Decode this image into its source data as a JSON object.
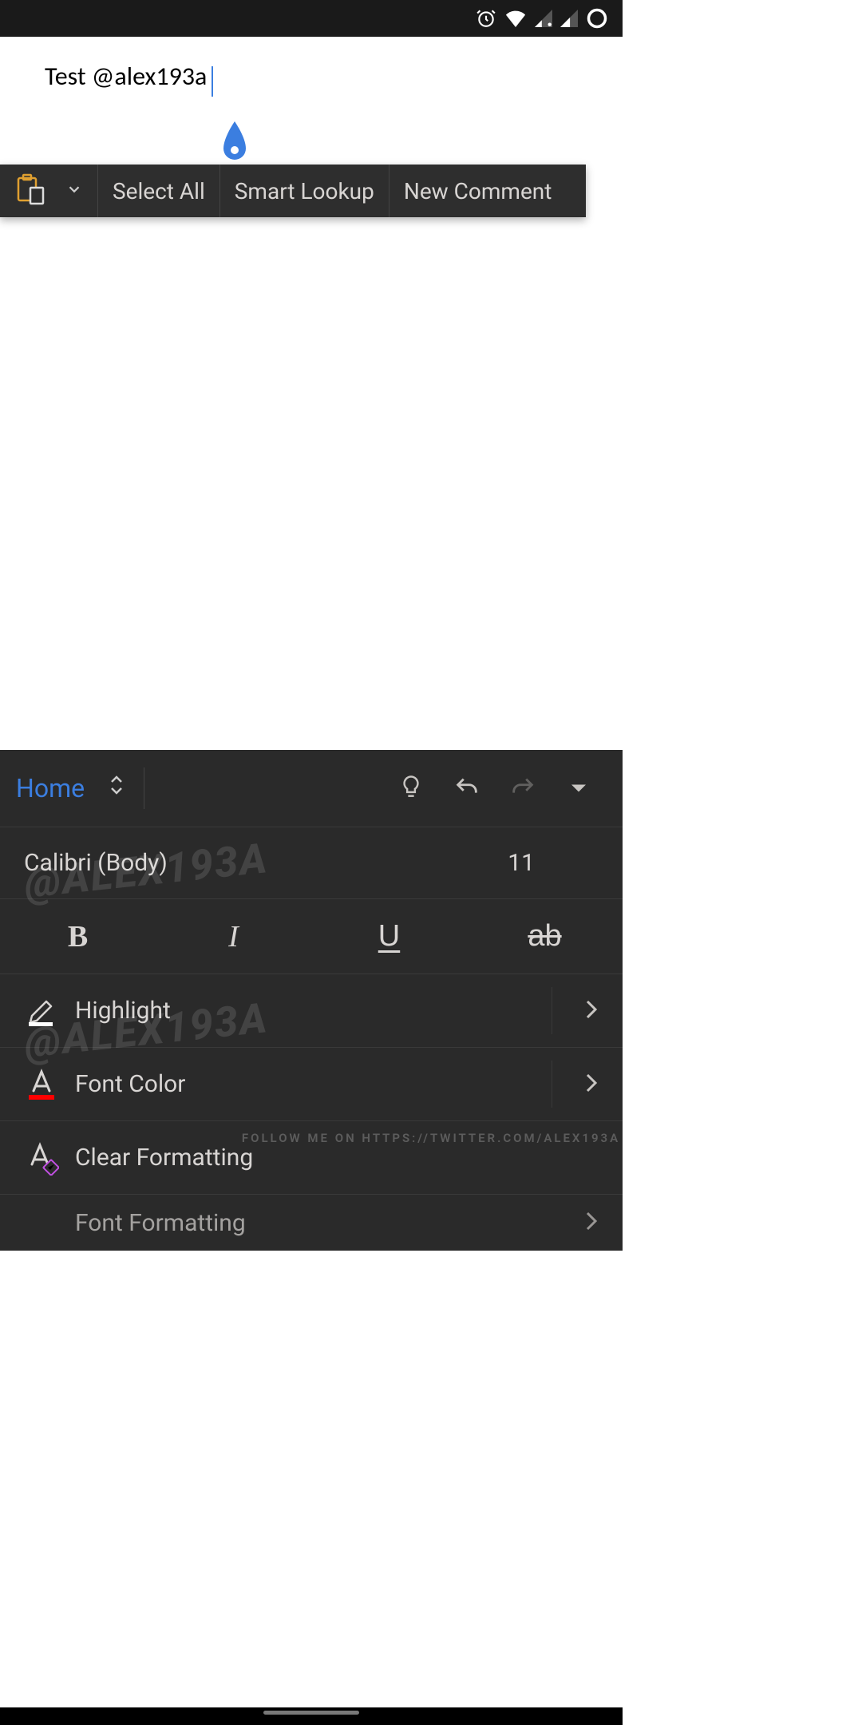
{
  "document": {
    "text": "Test @alex193a"
  },
  "context_menu": {
    "select_all": "Select All",
    "smart_lookup": "Smart Lookup",
    "new_comment": "New Comment"
  },
  "ribbon": {
    "tab": "Home",
    "font_row": {
      "font_name": "Calibri (Body)",
      "font_size": "11"
    },
    "style": {
      "bold": "B",
      "italic": "I",
      "underline": "U",
      "strike": "ab"
    },
    "menu": {
      "highlight": "Highlight",
      "font_color": "Font Color",
      "clear_formatting": "Clear Formatting",
      "font_formatting": "Font Formatting"
    }
  },
  "watermarks": {
    "handle": "@ALEX193A",
    "follow": "FOLLOW ME ON HTTPS://TWITTER.COM/ALEX193A"
  }
}
